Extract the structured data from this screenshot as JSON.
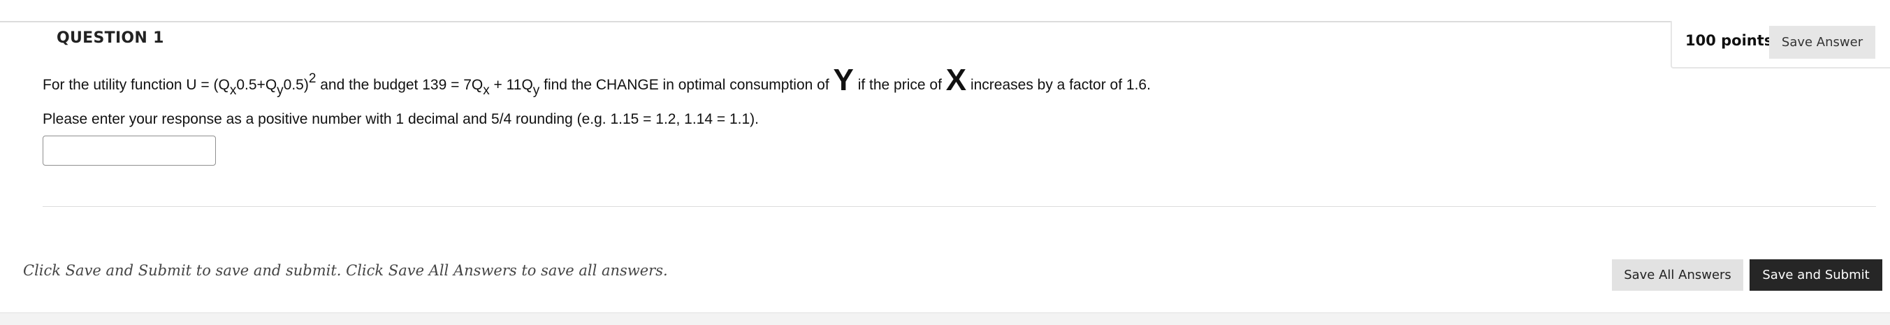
{
  "question": {
    "header": "QUESTION 1",
    "points": "100 points",
    "save_answer_label": "Save Answer",
    "text": {
      "intro": "For the utility function U = (Q",
      "sub_x1": "x",
      "mid1": "0.5+Q",
      "sub_y1": "y",
      "mid2": "0.5)",
      "sup_exp": "2",
      "mid3": " and the budget 139 = 7Q",
      "sub_x2": "x",
      "mid4": " + 11Q",
      "sub_y2": "y",
      "mid5": " find the CHANGE in optimal consumption of ",
      "var_y": "Y",
      "mid6": " if the price of ",
      "var_x": "X",
      "end": " increases by a factor of 1.6."
    },
    "instruction": "Please enter your response as a positive number with 1 decimal and 5/4 rounding (e.g. 1.15 = 1.2, 1.14 = 1.1).",
    "answer_value": "",
    "answer_placeholder": ""
  },
  "footer": {
    "note": "Click Save and Submit to save and submit. Click Save All Answers to save all answers.",
    "save_all_label": "Save All Answers",
    "save_submit_label": "Save and Submit"
  }
}
